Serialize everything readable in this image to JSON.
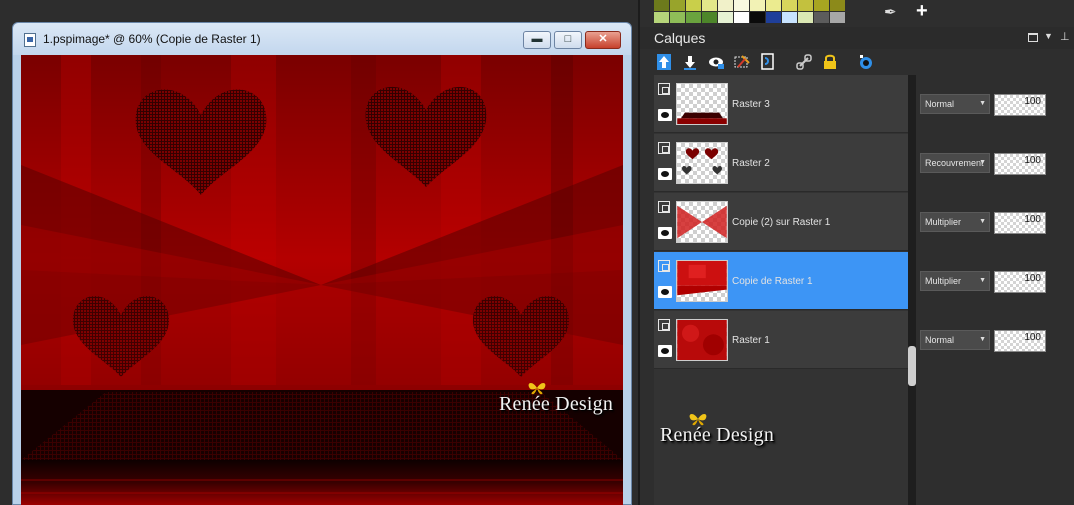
{
  "document": {
    "title": "1.pspimage* @  60% (Copie de Raster 1)",
    "min_label": "▬",
    "max_label": "□",
    "close_label": "✕",
    "watermark": "Renée Design"
  },
  "panel": {
    "title": "Calques",
    "watermark": "Renée Design",
    "palette": [
      "#6d7a1c",
      "#98a42b",
      "#c9cf4a",
      "#e3e88a",
      "#f1f1c9",
      "#f8f8e0",
      "#f2f2b5",
      "#ebeb8f",
      "#d8d65c",
      "#c3c13e",
      "#a7a521",
      "#8c8a1a",
      "#b6d57a",
      "#8fbd58",
      "#6aa33e",
      "#4d862a",
      "#e6f2d4",
      "#ffffff",
      "#0b0b0b",
      "#1f3f9a",
      "#c8e3ff",
      "#dbe8b4",
      "#5c5c5c",
      "#a7a7a7"
    ],
    "toolbar_icons": [
      "layer-up-icon",
      "layer-down-icon",
      "layer-visibility-icon",
      "layer-delete-icon",
      "layer-mask-icon",
      "link-icon",
      "lock-icon",
      "properties-icon"
    ]
  },
  "layers": [
    {
      "name": "Raster 3",
      "blend": "Normal",
      "opacity": "100",
      "selected": false
    },
    {
      "name": "Raster 2",
      "blend": "Recouvrement",
      "opacity": "100",
      "selected": false
    },
    {
      "name": "Copie (2) sur Raster 1",
      "blend": "Multiplier",
      "opacity": "100",
      "selected": false
    },
    {
      "name": "Copie de Raster 1",
      "blend": "Multiplier",
      "opacity": "100",
      "selected": true
    },
    {
      "name": "Raster 1",
      "blend": "Normal",
      "opacity": "100",
      "selected": false
    }
  ]
}
